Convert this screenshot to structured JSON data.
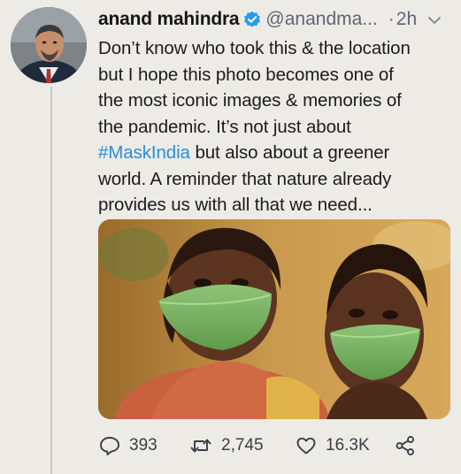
{
  "tweet": {
    "author_name": "anand mahindra",
    "handle": "@anandma...",
    "separator": "·",
    "time": "2h",
    "text_lines": [
      "Don’t know who took this & the location",
      "but I hope this photo becomes one of",
      "the most iconic images & memories of",
      "the pandemic. It’s not just about"
    ],
    "hashtag": "#MaskIndia",
    "hashtag_suffix": " but also about a greener",
    "text_lines_after": [
      "world. A reminder that nature already",
      "provides us with all that we need..."
    ],
    "reply_count": "393",
    "retweet_count": "2,745",
    "like_count": "16.3K"
  },
  "icons": {
    "verified": "verified-badge-icon",
    "more": "chevron-down-icon",
    "reply": "reply-icon",
    "retweet": "retweet-icon",
    "like": "heart-icon",
    "share": "share-icon"
  },
  "colors": {
    "background": "#ecebe6",
    "hashtag": "#2a8fd6",
    "verified": "#2a9be8",
    "muted_text": "#5e6670",
    "thread_line": "#c6c8c9"
  }
}
